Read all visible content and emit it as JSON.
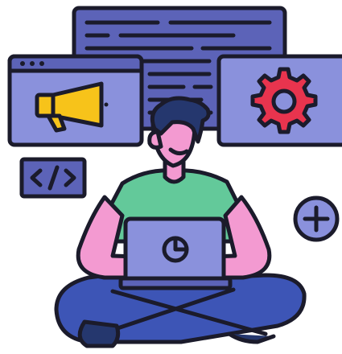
{
  "illustration": {
    "code_window": {
      "icon": "text-lines-icon"
    },
    "marketing_window": {
      "icon": "megaphone-icon",
      "dots": 3
    },
    "settings_window": {
      "icon": "gear-icon"
    },
    "code_tag": {
      "icon": "code-brackets-icon"
    },
    "plus_badge": {
      "icon": "plus-icon"
    },
    "laptop": {
      "icon": "pie-chart-icon"
    },
    "person": {
      "pose": "sitting-cross-legged"
    }
  },
  "colors": {
    "outline": "#1b1b2b",
    "panel_blue": "#8a91dc",
    "panel_dark": "#5c63b8",
    "megaphone_yellow": "#f7c31a",
    "gear_red": "#e8344e",
    "skin_pink": "#f39ad1",
    "shirt_green": "#63c99a",
    "hair_navy": "#25376e",
    "pants_blue": "#3d55b6",
    "background": "#ffffff"
  }
}
